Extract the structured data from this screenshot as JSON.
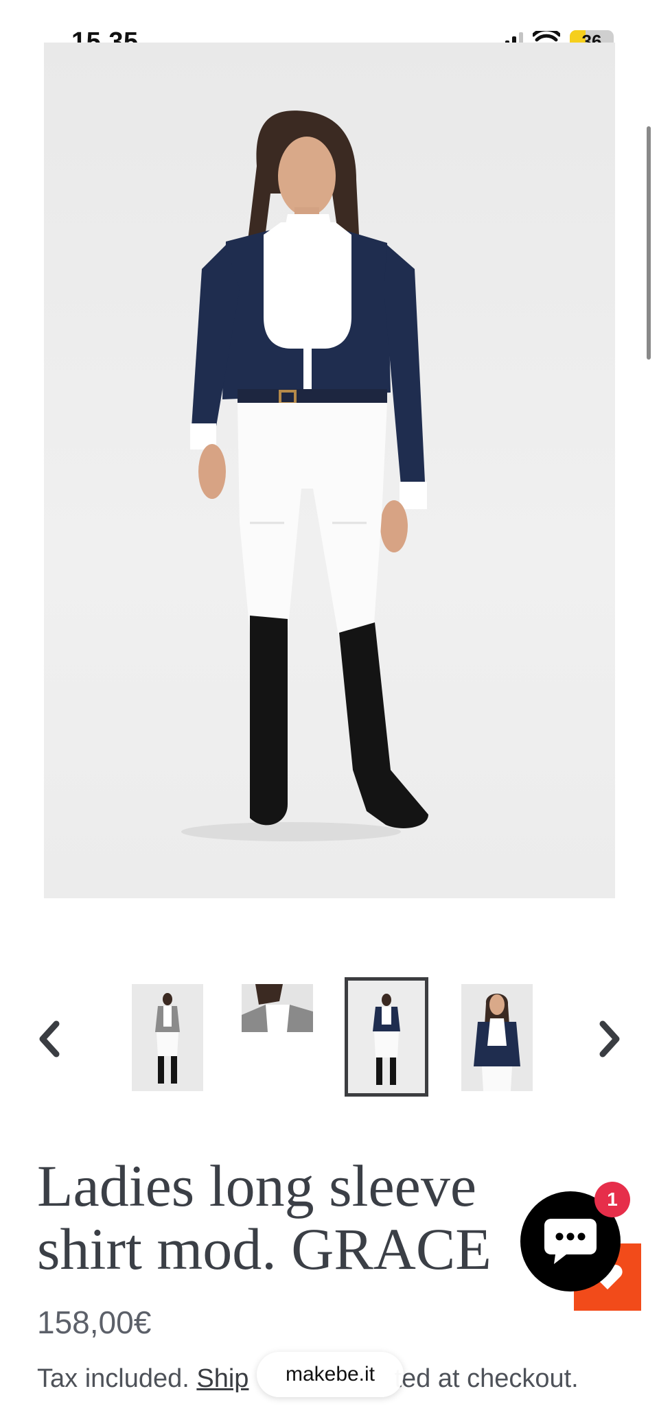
{
  "status_bar": {
    "time": "15.35",
    "battery": "36"
  },
  "product": {
    "title": "Ladies long sleeve shirt mod. GRACE",
    "price": "158,00€",
    "tax_before": "Tax included. ",
    "tax_link": "Ship",
    "tax_after": "ted at checkout."
  },
  "browser": {
    "url": "makebe.it"
  },
  "chat": {
    "badge_count": "1"
  },
  "thumbnails": {
    "count": 4,
    "active_index": 2
  },
  "colors": {
    "accent": "#f24b1a",
    "badge": "#e62e4a",
    "shirt_navy": "#1f2d4f"
  }
}
